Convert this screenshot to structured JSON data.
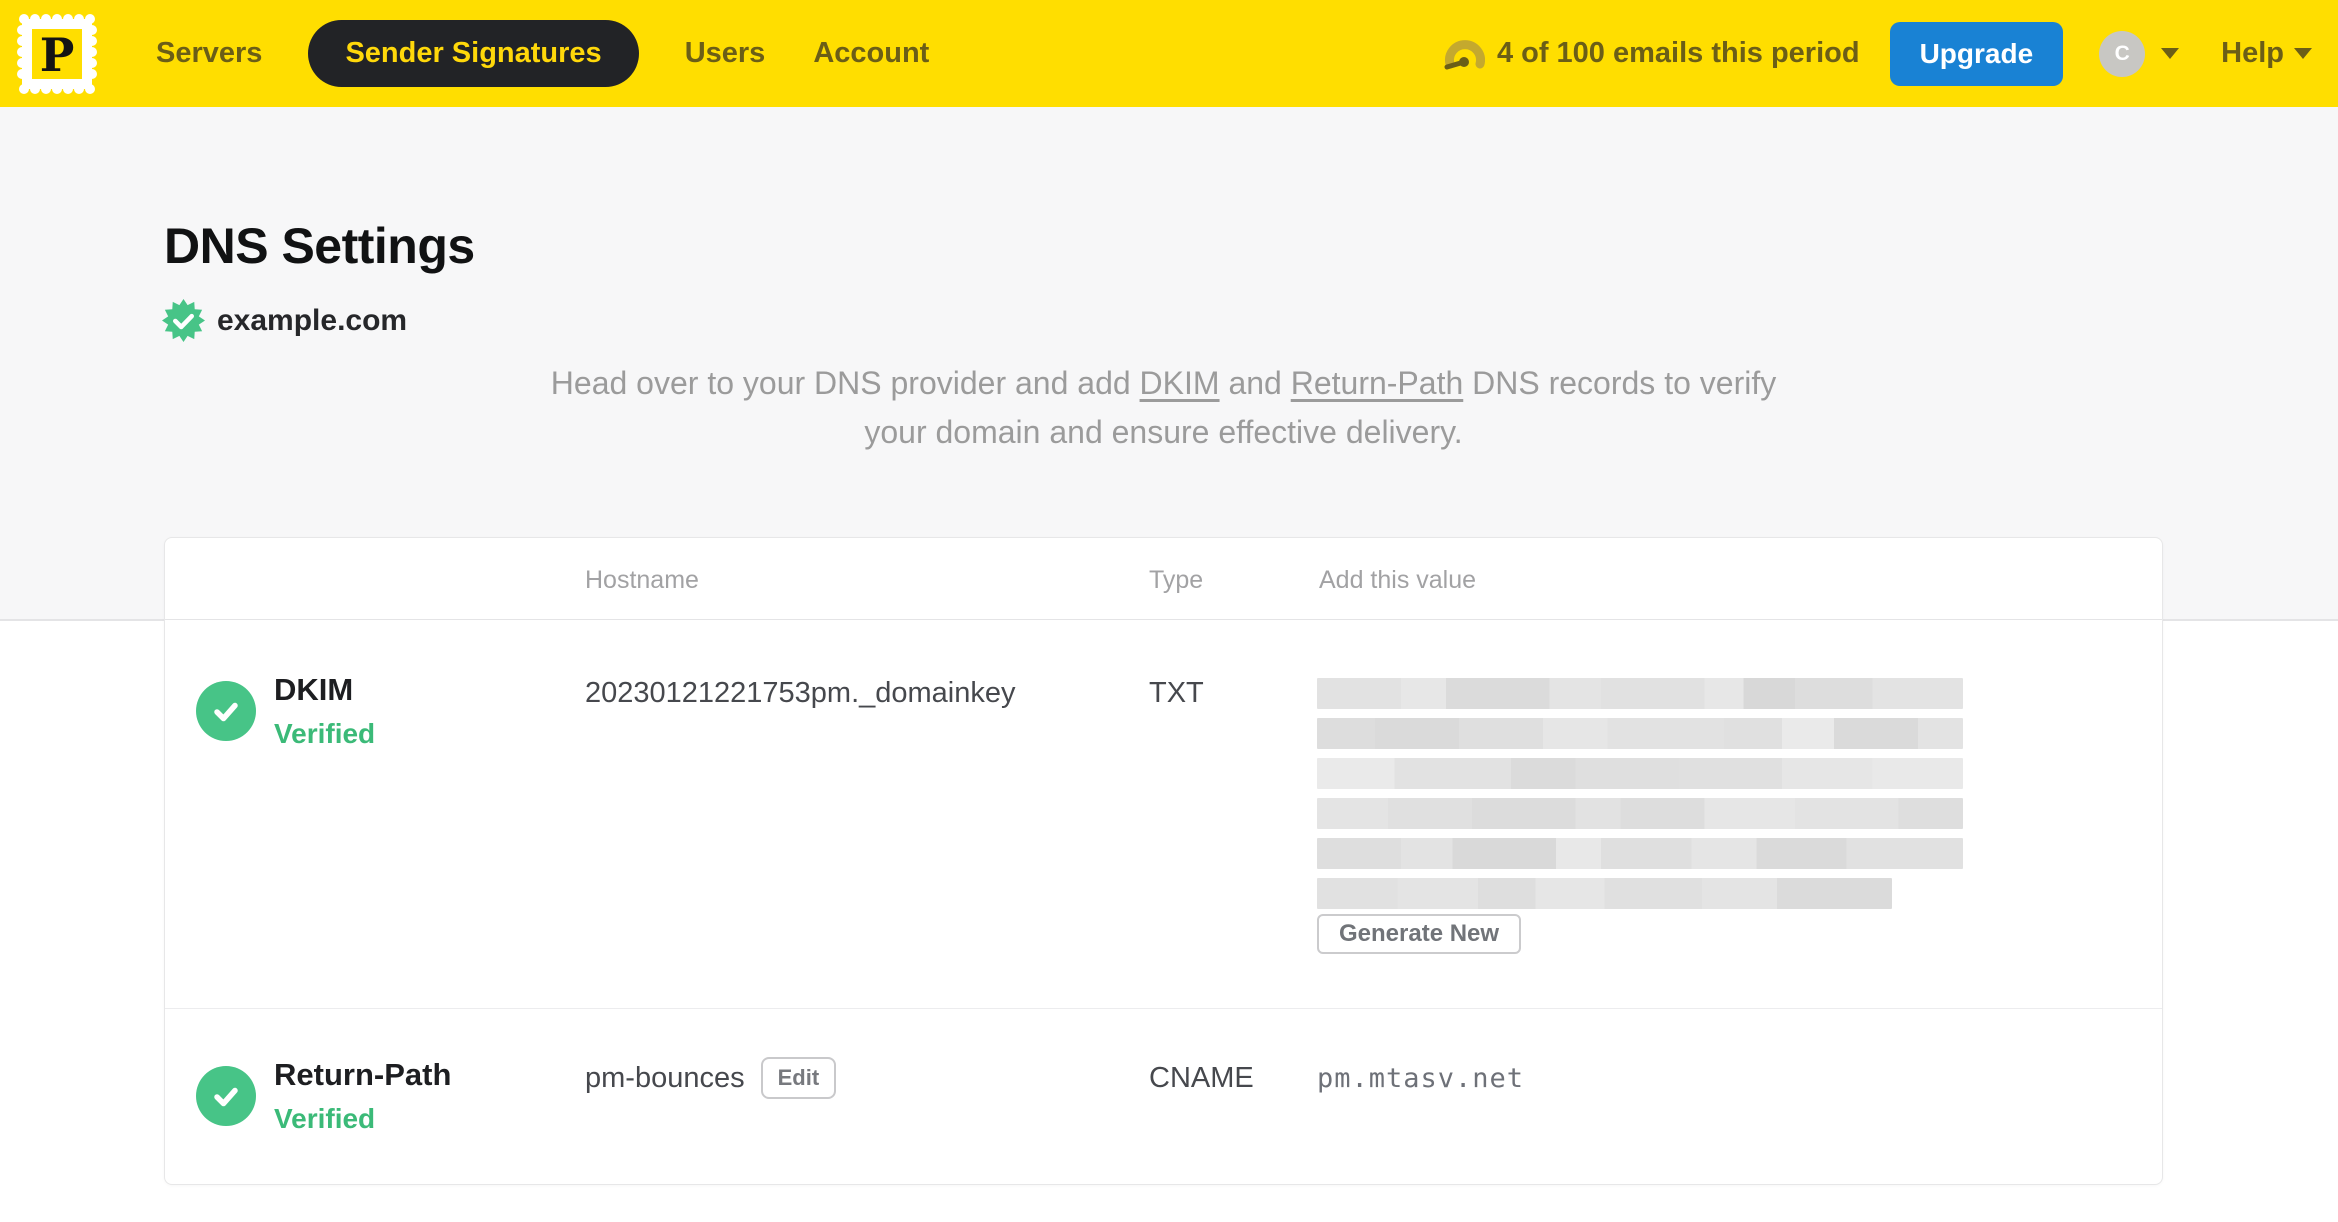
{
  "navbar": {
    "logo_letter": "P",
    "items": [
      {
        "label": "Servers",
        "active": false
      },
      {
        "label": "Sender Signatures",
        "active": true
      },
      {
        "label": "Users",
        "active": false
      },
      {
        "label": "Account",
        "active": false
      }
    ],
    "usage_text": "4 of 100 emails this period",
    "upgrade_label": "Upgrade",
    "avatar_letter": "C",
    "help_label": "Help"
  },
  "page": {
    "title": "DNS Settings",
    "domain": "example.com",
    "domain_verified": true,
    "description": {
      "part1": "Head over to your DNS provider and add ",
      "link_dkim": "DKIM",
      "part2": " and ",
      "link_return_path": "Return-Path",
      "part3": " DNS records to verify your domain and ensure effective delivery."
    }
  },
  "table": {
    "headers": {
      "hostname": "Hostname",
      "type": "Type",
      "value": "Add this value"
    },
    "rows": [
      {
        "name": "DKIM",
        "status": "Verified",
        "hostname": "20230121221753pm._domainkey",
        "type": "TXT",
        "value_redacted": true,
        "action_label": "Generate New"
      },
      {
        "name": "Return-Path",
        "status": "Verified",
        "hostname": "pm-bounces",
        "hostname_action_label": "Edit",
        "type": "CNAME",
        "value": "pm.mtasv.net"
      }
    ]
  },
  "icons": {
    "logo": "postmark-stamp-icon",
    "usage": "gauge-icon",
    "domain": "verified-seal-icon",
    "row_status": "check-circle-icon",
    "dropdown": "caret-down-icon"
  },
  "colors": {
    "brand_yellow": "#FFDE00",
    "nav_text": "#6B5E17",
    "nav_active_bg": "#222326",
    "upgrade_blue": "#1982D4",
    "verified_green": "#47C487",
    "muted_text": "#9B9B9B"
  }
}
